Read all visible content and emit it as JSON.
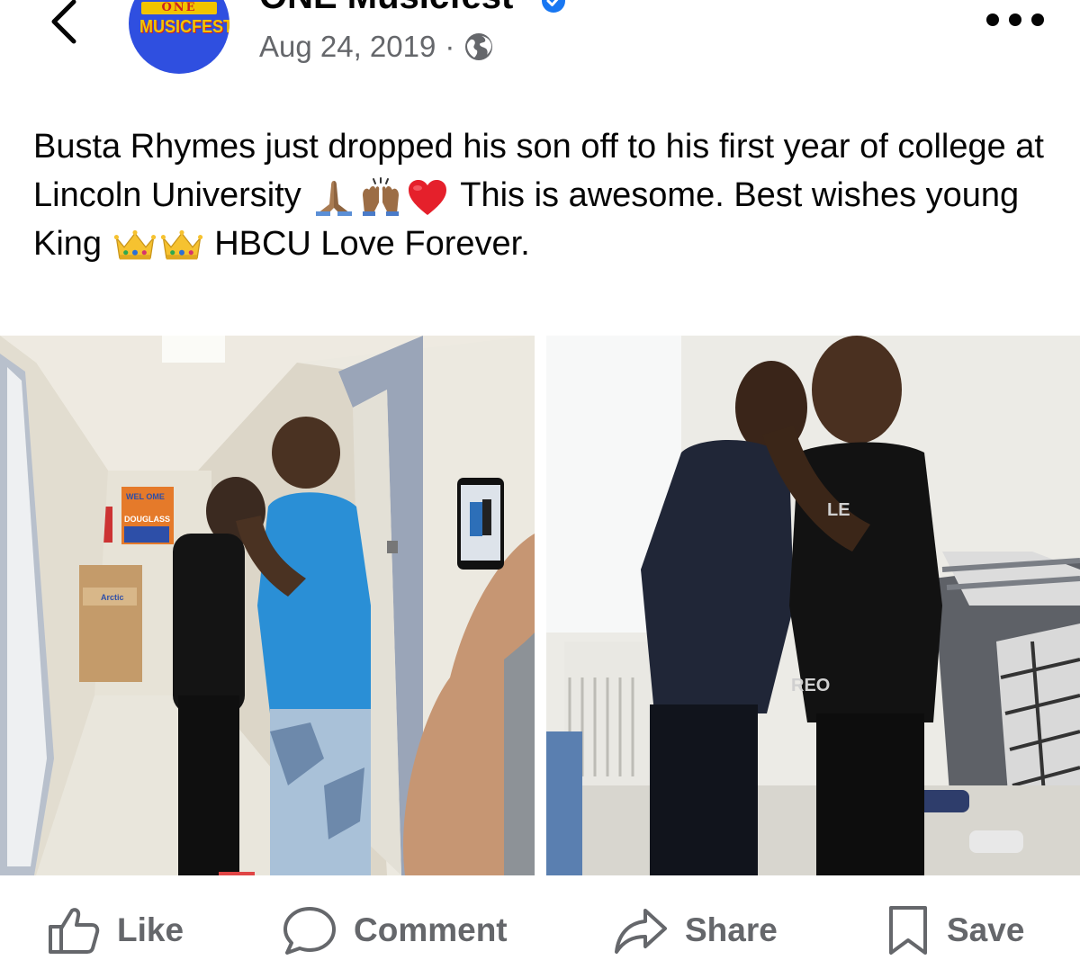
{
  "header": {
    "back_icon": "chevron-left-icon",
    "avatar_logo_top": "ONE",
    "avatar_logo_bottom": "MUSICFEST",
    "page_name": "ONE Musicfest",
    "verified_icon": "verified-badge-icon",
    "date": "Aug 24, 2019",
    "separator": "·",
    "audience_icon": "globe-icon",
    "more_icon": "more-options-icon"
  },
  "post": {
    "text_1": "Busta Rhymes just dropped his son off to his first year of college at Lincoln University",
    "emoji_1": [
      "folded-hands-emoji",
      "raised-hands-emoji",
      "red-heart-emoji"
    ],
    "text_2": "This is awesome. Best wishes young King",
    "emoji_2": [
      "crown-emoji",
      "crown-emoji"
    ],
    "text_3": "HBCU Love Forever."
  },
  "photos": {
    "left": {
      "wall_sign_top": "WEL  OME",
      "wall_sign_bottom": "DOUGLASS",
      "box_label": "Arctic"
    },
    "right": {
      "shirt_text_1": "LE",
      "shirt_text_2": "REO"
    }
  },
  "actions": {
    "like": "Like",
    "comment": "Comment",
    "share": "Share",
    "save": "Save"
  },
  "colors": {
    "text_primary": "#050505",
    "text_secondary": "#65676b",
    "verified_blue": "#1877f2",
    "avatar_blue": "#2f4fe0"
  }
}
